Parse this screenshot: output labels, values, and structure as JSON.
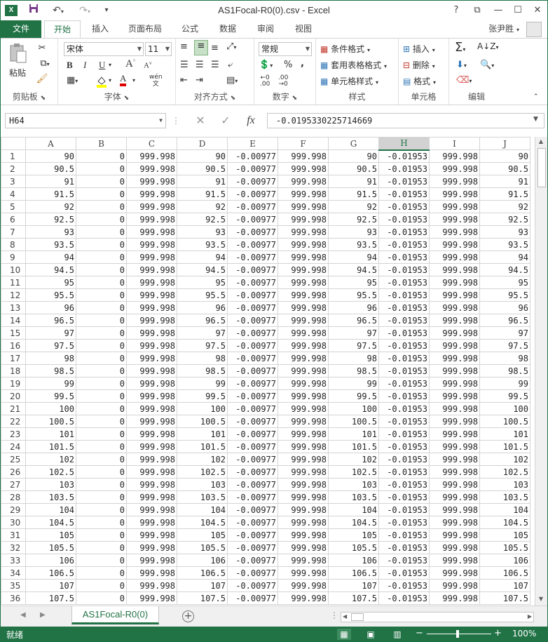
{
  "title": "AS1Focal-R0(0).csv - Excel",
  "window_controls": {
    "help": "?",
    "restore_ribbon": "⧉",
    "minimize": "—",
    "maximize": "☐",
    "close": "✕"
  },
  "icons": {
    "app": "excel-icon",
    "save": "save-icon",
    "undo": "undo-icon",
    "redo": "redo-icon",
    "qa_menu": "customize-quick-access-icon"
  },
  "tabs": {
    "file": "文件",
    "items": [
      "开始",
      "插入",
      "页面布局",
      "公式",
      "数据",
      "审阅",
      "视图"
    ],
    "active": "开始"
  },
  "user": "张尹胜",
  "ribbon": {
    "clipboard": {
      "label": "剪贴板",
      "paste": "粘贴"
    },
    "font": {
      "label": "字体",
      "name": "宋体",
      "size": "11",
      "bold": "B",
      "italic": "I",
      "underline": "U",
      "grow": "A",
      "shrink": "A",
      "wen": "wén",
      "font_color": "A"
    },
    "alignment": {
      "label": "对齐方式"
    },
    "number": {
      "label": "数字",
      "format": "常规",
      "percent": "%",
      "comma": ","
    },
    "styles": {
      "label": "样式",
      "conditional": "条件格式",
      "table": "套用表格格式",
      "cell": "单元格样式"
    },
    "cells": {
      "label": "单元格",
      "insert": "插入",
      "delete": "删除",
      "format": "格式"
    },
    "editing": {
      "label": "编辑"
    }
  },
  "formula_bar": {
    "name_box": "H64",
    "fx": "fx",
    "formula": "-0.0195330225714669"
  },
  "columns": [
    "A",
    "B",
    "C",
    "D",
    "E",
    "F",
    "G",
    "H",
    "I",
    "J"
  ],
  "selected_column": "H",
  "rows": [
    {
      "n": "1",
      "cells": [
        "90",
        "0",
        "999.998",
        "90",
        "-0.00977",
        "999.998",
        "90",
        "-0.01953",
        "999.998",
        "90"
      ]
    },
    {
      "n": "2",
      "cells": [
        "90.5",
        "0",
        "999.998",
        "90.5",
        "-0.00977",
        "999.998",
        "90.5",
        "-0.01953",
        "999.998",
        "90.5"
      ]
    },
    {
      "n": "3",
      "cells": [
        "91",
        "0",
        "999.998",
        "91",
        "-0.00977",
        "999.998",
        "91",
        "-0.01953",
        "999.998",
        "91"
      ]
    },
    {
      "n": "4",
      "cells": [
        "91.5",
        "0",
        "999.998",
        "91.5",
        "-0.00977",
        "999.998",
        "91.5",
        "-0.01953",
        "999.998",
        "91.5"
      ]
    },
    {
      "n": "5",
      "cells": [
        "92",
        "0",
        "999.998",
        "92",
        "-0.00977",
        "999.998",
        "92",
        "-0.01953",
        "999.998",
        "92"
      ]
    },
    {
      "n": "6",
      "cells": [
        "92.5",
        "0",
        "999.998",
        "92.5",
        "-0.00977",
        "999.998",
        "92.5",
        "-0.01953",
        "999.998",
        "92.5"
      ]
    },
    {
      "n": "7",
      "cells": [
        "93",
        "0",
        "999.998",
        "93",
        "-0.00977",
        "999.998",
        "93",
        "-0.01953",
        "999.998",
        "93"
      ]
    },
    {
      "n": "8",
      "cells": [
        "93.5",
        "0",
        "999.998",
        "93.5",
        "-0.00977",
        "999.998",
        "93.5",
        "-0.01953",
        "999.998",
        "93.5"
      ]
    },
    {
      "n": "9",
      "cells": [
        "94",
        "0",
        "999.998",
        "94",
        "-0.00977",
        "999.998",
        "94",
        "-0.01953",
        "999.998",
        "94"
      ]
    },
    {
      "n": "10",
      "cells": [
        "94.5",
        "0",
        "999.998",
        "94.5",
        "-0.00977",
        "999.998",
        "94.5",
        "-0.01953",
        "999.998",
        "94.5"
      ]
    },
    {
      "n": "11",
      "cells": [
        "95",
        "0",
        "999.998",
        "95",
        "-0.00977",
        "999.998",
        "95",
        "-0.01953",
        "999.998",
        "95"
      ]
    },
    {
      "n": "12",
      "cells": [
        "95.5",
        "0",
        "999.998",
        "95.5",
        "-0.00977",
        "999.998",
        "95.5",
        "-0.01953",
        "999.998",
        "95.5"
      ]
    },
    {
      "n": "13",
      "cells": [
        "96",
        "0",
        "999.998",
        "96",
        "-0.00977",
        "999.998",
        "96",
        "-0.01953",
        "999.998",
        "96"
      ]
    },
    {
      "n": "14",
      "cells": [
        "96.5",
        "0",
        "999.998",
        "96.5",
        "-0.00977",
        "999.998",
        "96.5",
        "-0.01953",
        "999.998",
        "96.5"
      ]
    },
    {
      "n": "15",
      "cells": [
        "97",
        "0",
        "999.998",
        "97",
        "-0.00977",
        "999.998",
        "97",
        "-0.01953",
        "999.998",
        "97"
      ]
    },
    {
      "n": "16",
      "cells": [
        "97.5",
        "0",
        "999.998",
        "97.5",
        "-0.00977",
        "999.998",
        "97.5",
        "-0.01953",
        "999.998",
        "97.5"
      ]
    },
    {
      "n": "17",
      "cells": [
        "98",
        "0",
        "999.998",
        "98",
        "-0.00977",
        "999.998",
        "98",
        "-0.01953",
        "999.998",
        "98"
      ]
    },
    {
      "n": "18",
      "cells": [
        "98.5",
        "0",
        "999.998",
        "98.5",
        "-0.00977",
        "999.998",
        "98.5",
        "-0.01953",
        "999.998",
        "98.5"
      ]
    },
    {
      "n": "19",
      "cells": [
        "99",
        "0",
        "999.998",
        "99",
        "-0.00977",
        "999.998",
        "99",
        "-0.01953",
        "999.998",
        "99"
      ]
    },
    {
      "n": "20",
      "cells": [
        "99.5",
        "0",
        "999.998",
        "99.5",
        "-0.00977",
        "999.998",
        "99.5",
        "-0.01953",
        "999.998",
        "99.5"
      ]
    },
    {
      "n": "21",
      "cells": [
        "100",
        "0",
        "999.998",
        "100",
        "-0.00977",
        "999.998",
        "100",
        "-0.01953",
        "999.998",
        "100"
      ]
    },
    {
      "n": "22",
      "cells": [
        "100.5",
        "0",
        "999.998",
        "100.5",
        "-0.00977",
        "999.998",
        "100.5",
        "-0.01953",
        "999.998",
        "100.5"
      ]
    },
    {
      "n": "23",
      "cells": [
        "101",
        "0",
        "999.998",
        "101",
        "-0.00977",
        "999.998",
        "101",
        "-0.01953",
        "999.998",
        "101"
      ]
    },
    {
      "n": "24",
      "cells": [
        "101.5",
        "0",
        "999.998",
        "101.5",
        "-0.00977",
        "999.998",
        "101.5",
        "-0.01953",
        "999.998",
        "101.5"
      ]
    },
    {
      "n": "25",
      "cells": [
        "102",
        "0",
        "999.998",
        "102",
        "-0.00977",
        "999.998",
        "102",
        "-0.01953",
        "999.998",
        "102"
      ]
    },
    {
      "n": "26",
      "cells": [
        "102.5",
        "0",
        "999.998",
        "102.5",
        "-0.00977",
        "999.998",
        "102.5",
        "-0.01953",
        "999.998",
        "102.5"
      ]
    },
    {
      "n": "27",
      "cells": [
        "103",
        "0",
        "999.998",
        "103",
        "-0.00977",
        "999.998",
        "103",
        "-0.01953",
        "999.998",
        "103"
      ]
    },
    {
      "n": "28",
      "cells": [
        "103.5",
        "0",
        "999.998",
        "103.5",
        "-0.00977",
        "999.998",
        "103.5",
        "-0.01953",
        "999.998",
        "103.5"
      ]
    },
    {
      "n": "29",
      "cells": [
        "104",
        "0",
        "999.998",
        "104",
        "-0.00977",
        "999.998",
        "104",
        "-0.01953",
        "999.998",
        "104"
      ]
    },
    {
      "n": "30",
      "cells": [
        "104.5",
        "0",
        "999.998",
        "104.5",
        "-0.00977",
        "999.998",
        "104.5",
        "-0.01953",
        "999.998",
        "104.5"
      ]
    },
    {
      "n": "31",
      "cells": [
        "105",
        "0",
        "999.998",
        "105",
        "-0.00977",
        "999.998",
        "105",
        "-0.01953",
        "999.998",
        "105"
      ]
    },
    {
      "n": "32",
      "cells": [
        "105.5",
        "0",
        "999.998",
        "105.5",
        "-0.00977",
        "999.998",
        "105.5",
        "-0.01953",
        "999.998",
        "105.5"
      ]
    },
    {
      "n": "33",
      "cells": [
        "106",
        "0",
        "999.998",
        "106",
        "-0.00977",
        "999.998",
        "106",
        "-0.01953",
        "999.998",
        "106"
      ]
    },
    {
      "n": "34",
      "cells": [
        "106.5",
        "0",
        "999.998",
        "106.5",
        "-0.00977",
        "999.998",
        "106.5",
        "-0.01953",
        "999.998",
        "106.5"
      ]
    },
    {
      "n": "35",
      "cells": [
        "107",
        "0",
        "999.998",
        "107",
        "-0.00977",
        "999.998",
        "107",
        "-0.01953",
        "999.998",
        "107"
      ]
    },
    {
      "n": "36",
      "cells": [
        "107.5",
        "0",
        "999.998",
        "107.5",
        "-0.00977",
        "999.998",
        "107.5",
        "-0.01953",
        "999.998",
        "107.5"
      ]
    }
  ],
  "sheet_tab": "AS1Focal-R0(0)",
  "status": {
    "text": "就绪",
    "zoom": "100%",
    "zoom_minus": "−",
    "zoom_plus": "+"
  },
  "colors": {
    "accent": "#217346",
    "gridline": "#d4d4d4",
    "selected_header": "#d2d2d2"
  }
}
